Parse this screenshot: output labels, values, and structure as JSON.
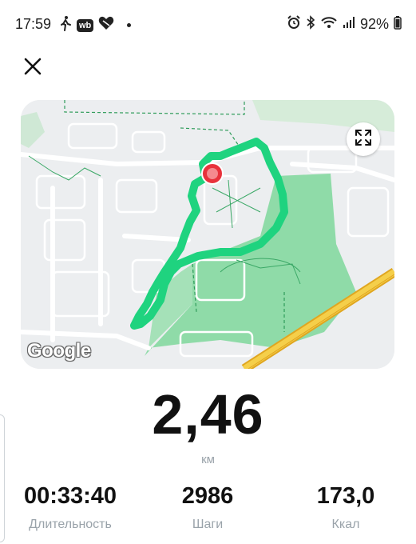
{
  "status_bar": {
    "time": "17:59",
    "wb_badge": "wb",
    "battery": "92%",
    "icons": [
      "walk-icon",
      "heart-icon",
      "alarm-icon",
      "bluetooth-icon",
      "wifi-icon",
      "signal-icon",
      "battery-icon"
    ]
  },
  "header": {
    "close_icon": "close-icon"
  },
  "map": {
    "route_color": "#1fd37f",
    "marker_color": "#e8323c",
    "park_color": "#8fdba8",
    "highway_color": "#f1c232",
    "attribution": "Google",
    "expand_icon": "expand-icon"
  },
  "summary": {
    "distance": "2,46",
    "distance_unit": "км"
  },
  "stats": [
    {
      "value": "00:33:40",
      "label": "Длительность"
    },
    {
      "value": "2986",
      "label": "Шаги"
    },
    {
      "value": "173,0",
      "label": "Ккал"
    }
  ]
}
